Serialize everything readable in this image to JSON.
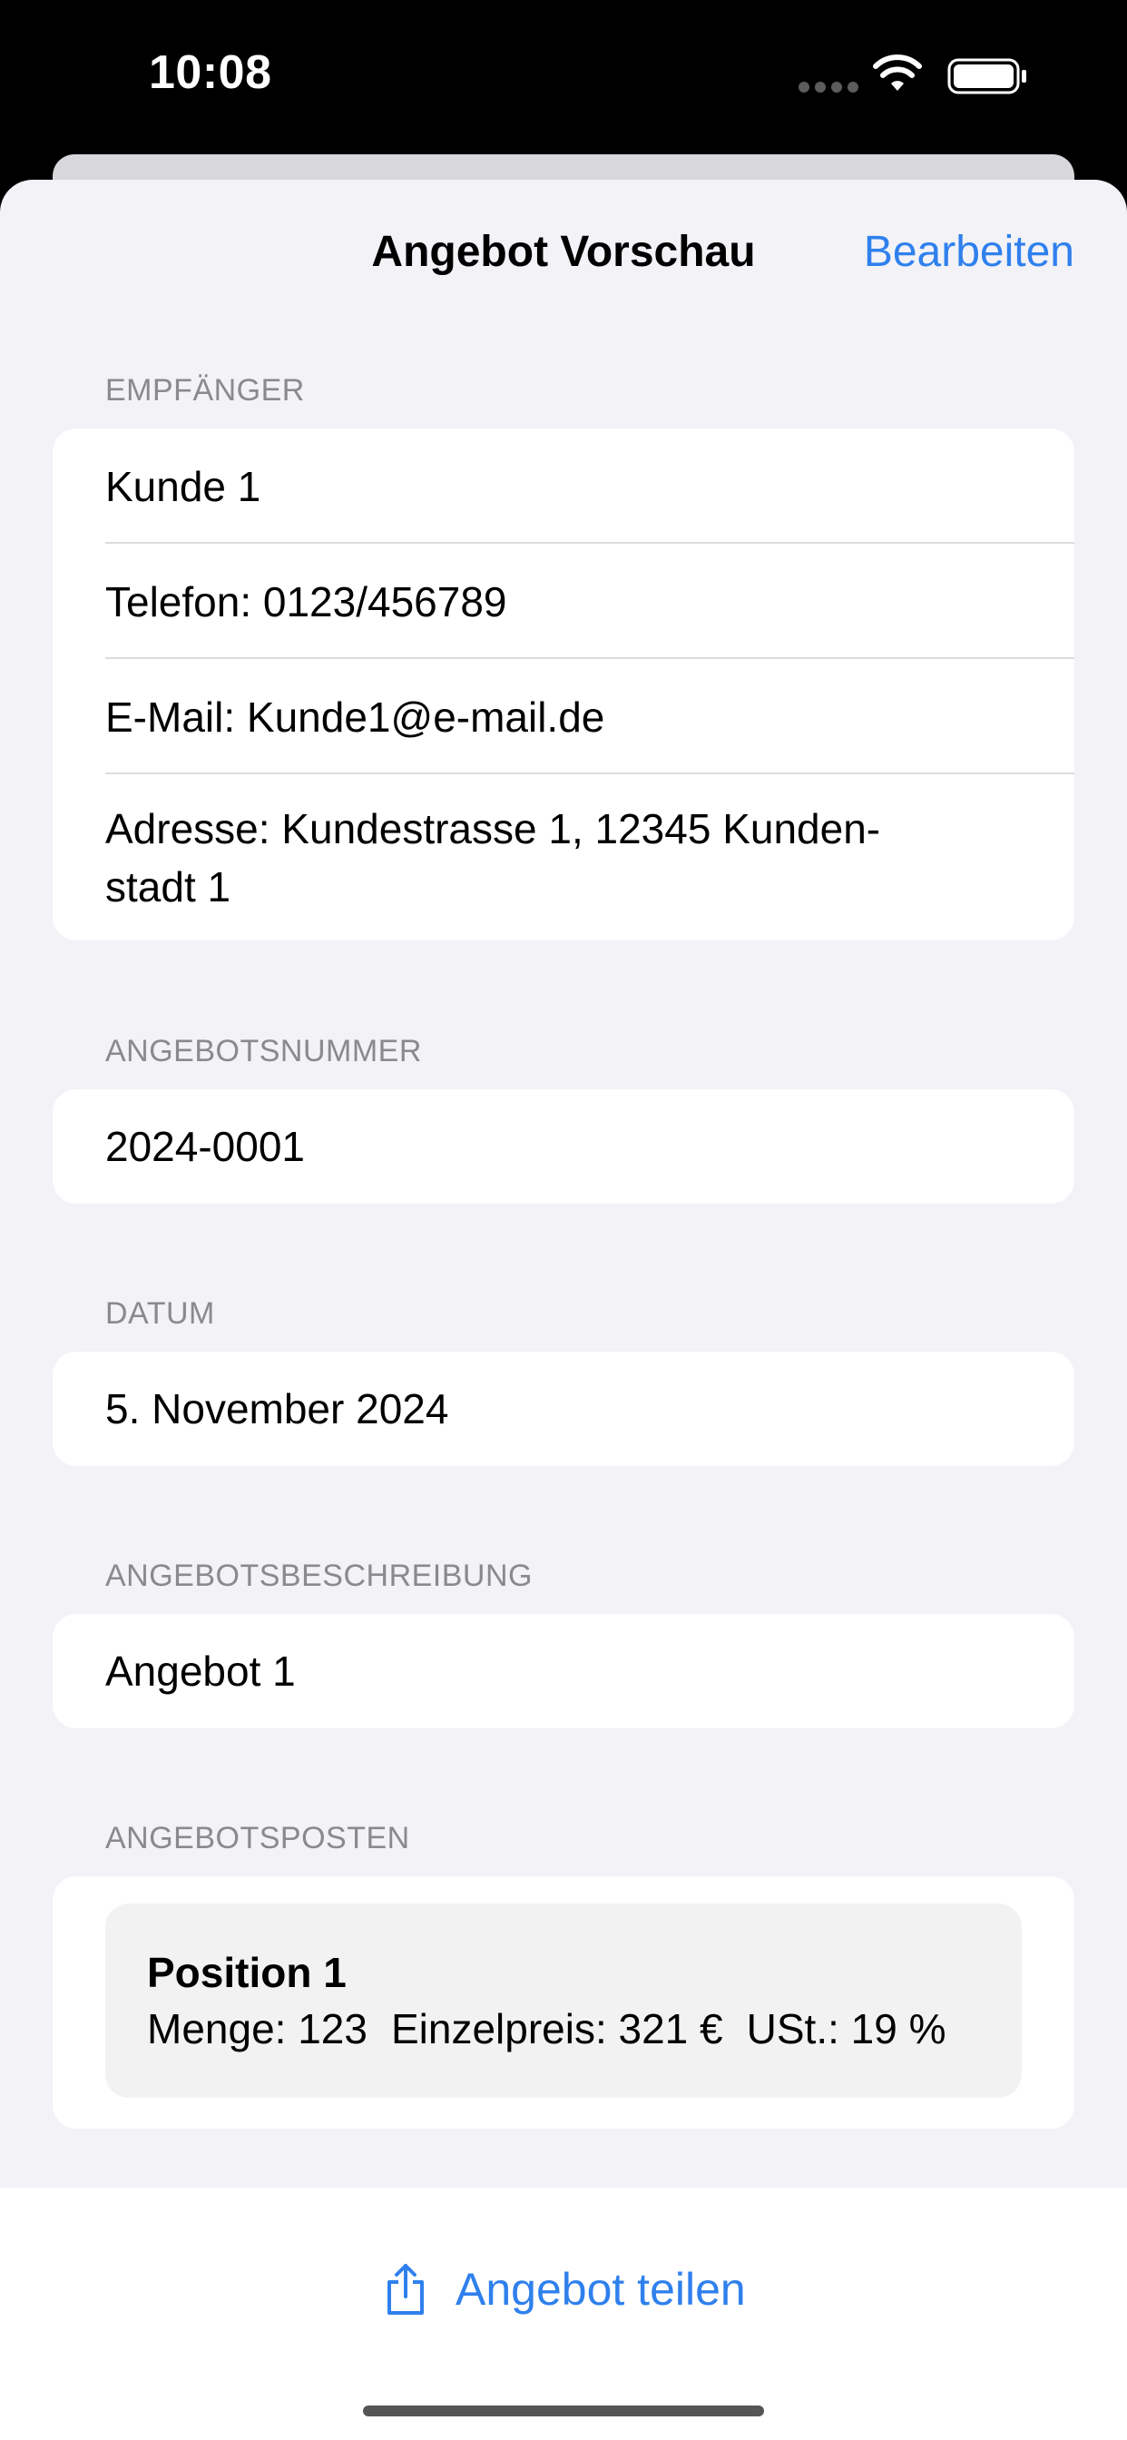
{
  "status_bar": {
    "time": "10:08",
    "icons": [
      "cellular-dots-icon",
      "wifi-icon",
      "battery-icon"
    ]
  },
  "nav": {
    "title": "Angebot Vorschau",
    "edit_label": "Bearbeiten"
  },
  "sections": {
    "recipient": {
      "header": "EMPFÄNGER",
      "name": "Kunde 1",
      "phone": "Telefon: 0123/456789",
      "email": "E-Mail: Kunde1@e-mail.de",
      "address_line1": "Adresse: Kundestrasse 1, 12345 Kunden-",
      "address_line2": "stadt 1"
    },
    "offer_number": {
      "header": "ANGEBOTSNUMMER",
      "value": "2024-0001"
    },
    "date": {
      "header": "DATUM",
      "value": "5. November 2024"
    },
    "description": {
      "header": "ANGEBOTSBESCHREIBUNG",
      "value": "Angebot 1"
    },
    "items": {
      "header": "ANGEBOTSPOSTEN",
      "list": [
        {
          "title": "Position 1",
          "quantity": "Menge: 123",
          "unit_price": "Einzelpreis: 321 €",
          "vat": "USt.: 19 %"
        }
      ]
    }
  },
  "bottom": {
    "share_label": "Angebot teilen",
    "share_icon": "share-icon"
  },
  "colors": {
    "accent": "#2f80ed",
    "background": "#f2f2f7",
    "card": "#ffffff",
    "section_header": "#8a8a8e"
  }
}
